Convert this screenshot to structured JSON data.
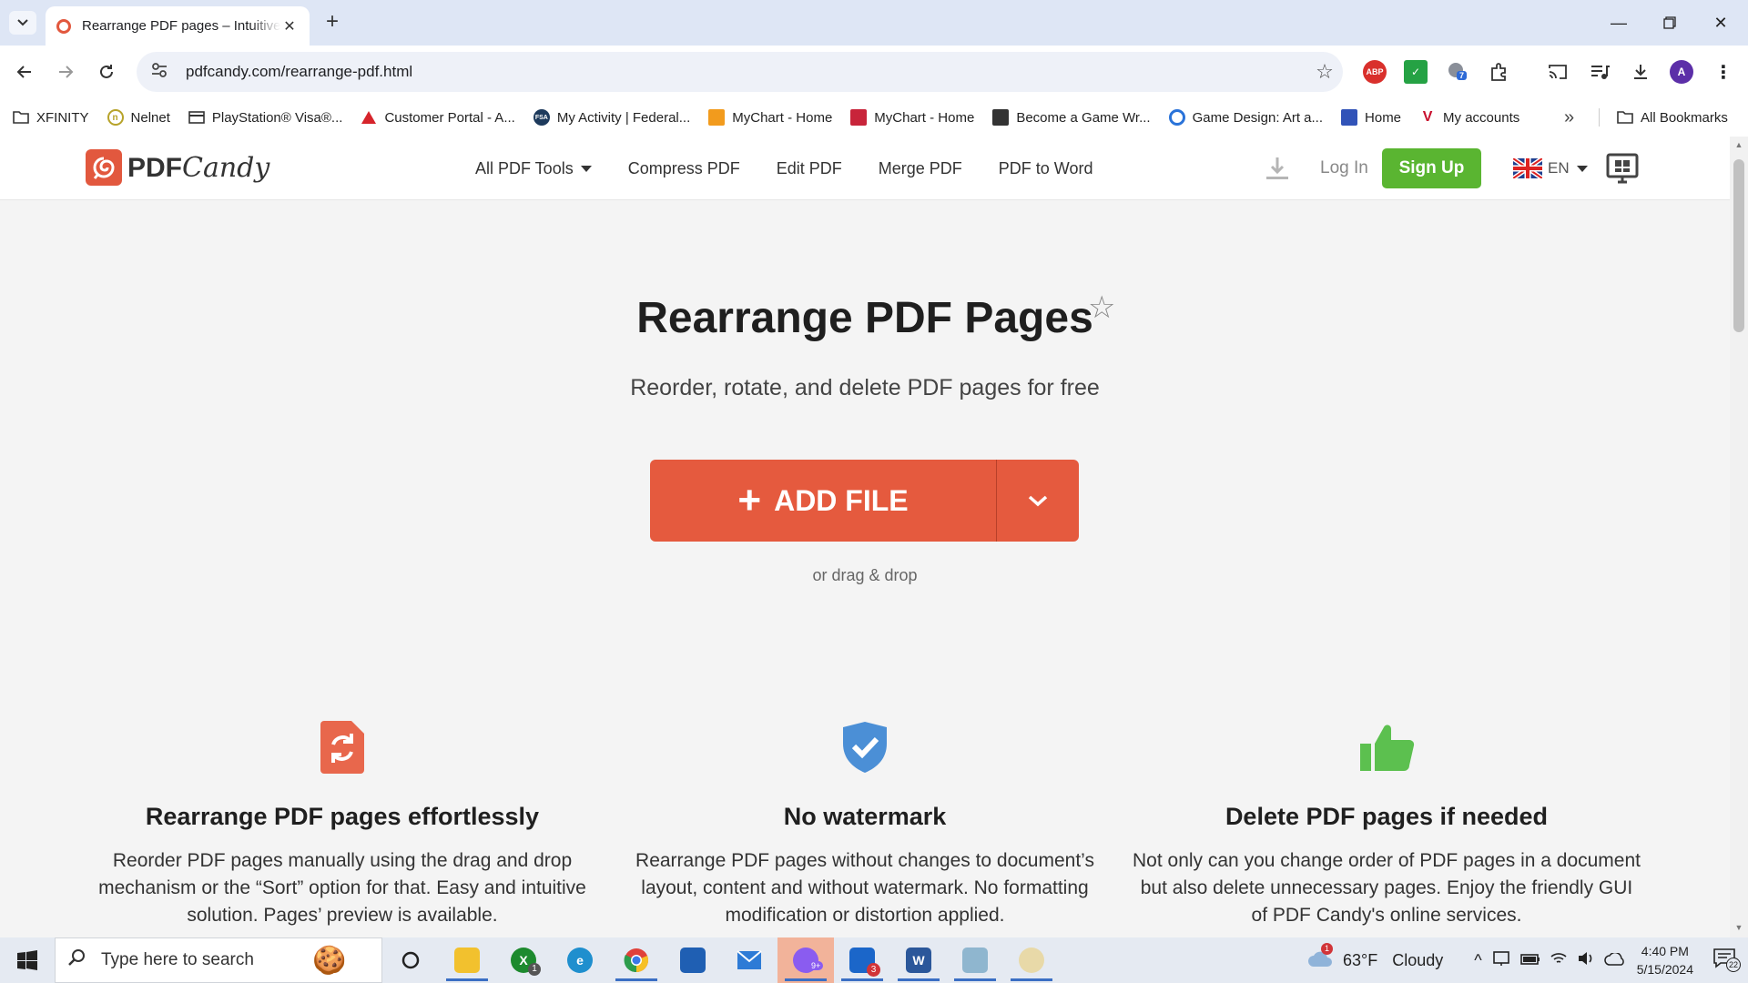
{
  "browser": {
    "tab_title": "Rearrange PDF pages – Intuitive",
    "url": "pdfcandy.com/rearrange-pdf.html",
    "profile_initial": "A",
    "extension_badge": "7",
    "abp_label": "ABP",
    "bookmarks": [
      {
        "label": "XFINITY",
        "icon": "folder-icon"
      },
      {
        "label": "Nelnet",
        "icon": "nelnet-icon"
      },
      {
        "label": "PlayStation® Visa®...",
        "icon": "card-icon"
      },
      {
        "label": "Customer Portal - A...",
        "icon": "portal-icon"
      },
      {
        "label": "My Activity | Federal...",
        "icon": "fsa-icon"
      },
      {
        "label": "MyChart - Home",
        "icon": "mychart-icon"
      },
      {
        "label": "MyChart - Home",
        "icon": "mychart-red-icon"
      },
      {
        "label": "Become a Game Wr...",
        "icon": "profile-card-icon"
      },
      {
        "label": "Game Design: Art a...",
        "icon": "coursera-icon"
      },
      {
        "label": "Home",
        "icon": "grid-icon"
      },
      {
        "label": "My accounts",
        "icon": "v-icon"
      }
    ],
    "more_label": "»",
    "all_bookmarks": "All Bookmarks"
  },
  "site": {
    "logo_bold": "PDF",
    "logo_script": "Candy",
    "nav": [
      "All PDF Tools",
      "Compress PDF",
      "Edit PDF",
      "Merge PDF",
      "PDF to Word"
    ],
    "login": "Log In",
    "signup": "Sign Up",
    "lang": "EN"
  },
  "hero": {
    "title": "Rearrange PDF Pages",
    "subtitle": "Reorder, rotate, and delete PDF pages for free",
    "add_file": "ADD FILE",
    "drag_drop": "or drag & drop"
  },
  "features": [
    {
      "title": "Rearrange PDF pages effortlessly",
      "text": "Reorder PDF pages manually using the drag and drop mechanism or the “Sort” option for that. Easy and intuitive solution. Pages’ preview is available.",
      "icon": "rotate-doc-icon",
      "color": "#e8674c"
    },
    {
      "title": "No watermark",
      "text": "Rearrange PDF pages without changes to document’s layout, content and without watermark. No formatting modification or distortion applied.",
      "icon": "shield-check-icon",
      "color": "#4b8fd6"
    },
    {
      "title": "Delete PDF pages if needed",
      "text": "Not only can you change order of PDF pages in a document but also delete unnecessary pages. Enjoy the friendly GUI of PDF Candy's online services.",
      "icon": "thumbs-up-icon",
      "color": "#5cc04f"
    }
  ],
  "taskbar": {
    "search_placeholder": "Type here to search",
    "weather_temp": "63°F",
    "weather_desc": "Cloudy",
    "time": "4:40 PM",
    "date": "5/15/2024",
    "notif_count": "22",
    "weather_badge": "1",
    "xbox_badge": "1",
    "app_badge": "9+",
    "mail_badge": "3"
  },
  "colors": {
    "brand": "#e2583e",
    "signup": "#5ab531"
  }
}
